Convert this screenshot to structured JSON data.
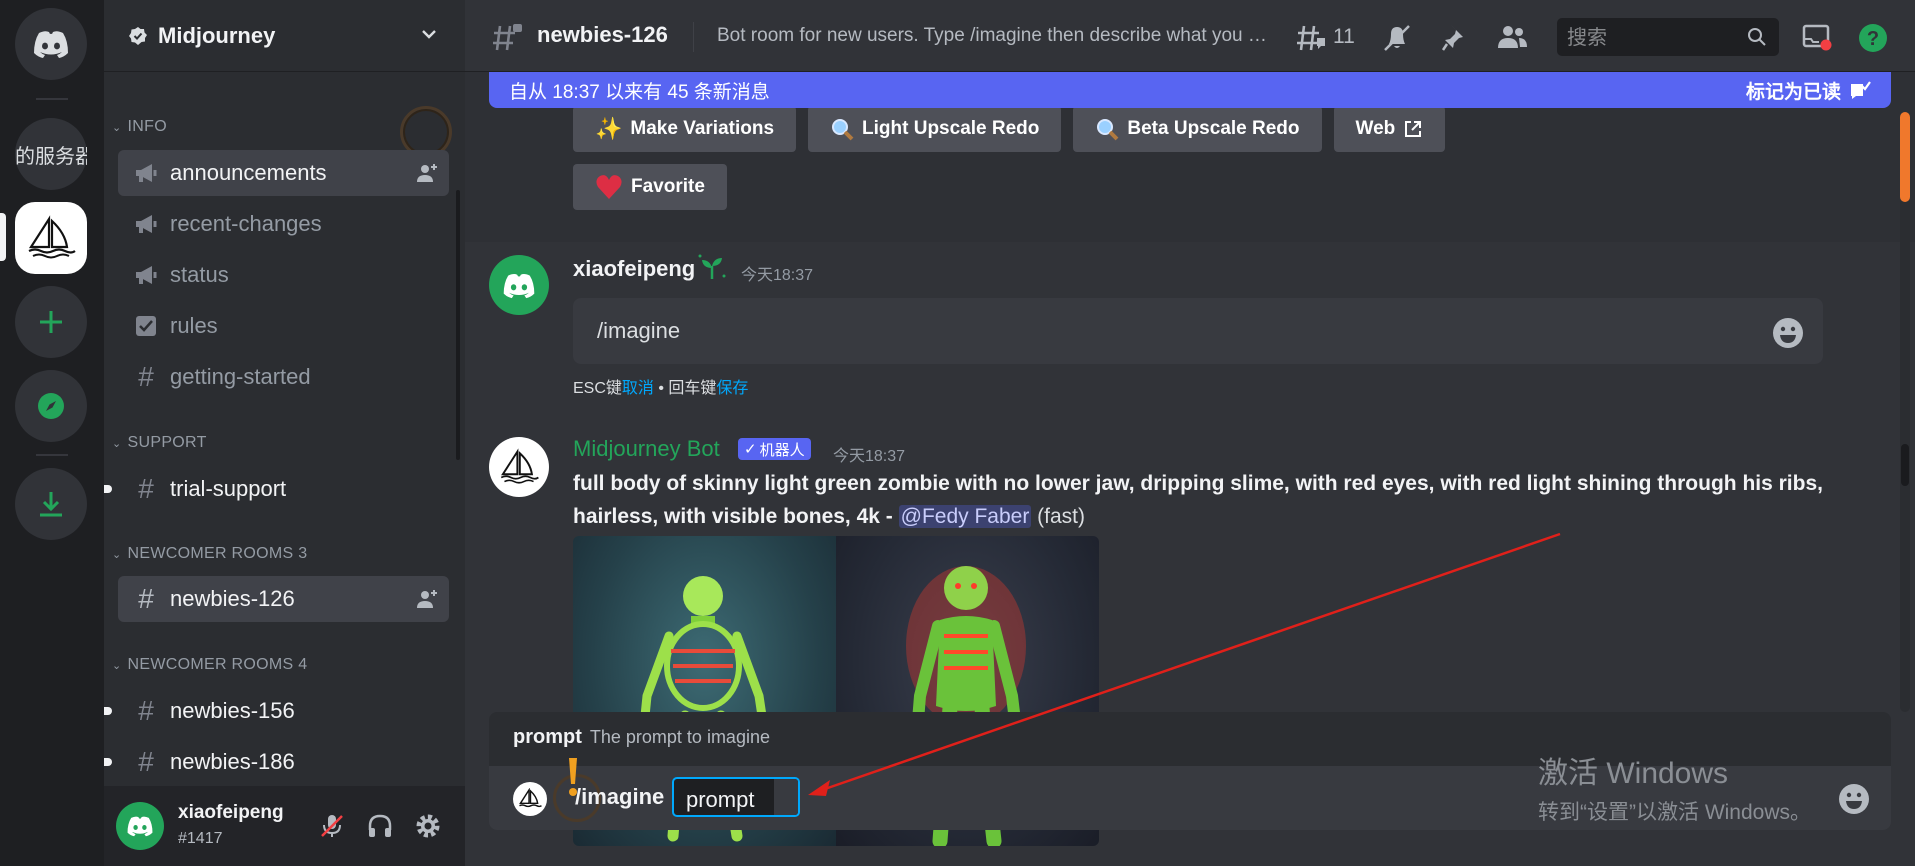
{
  "server_rail": {
    "servers_label": "的服务器"
  },
  "guild": {
    "name": "Midjourney"
  },
  "sidebar": {
    "categories": {
      "info": "INFO",
      "support": "SUPPORT",
      "rooms3": "NEWCOMER ROOMS 3",
      "rooms4": "NEWCOMER ROOMS 4"
    },
    "channels": {
      "announcements": "announcements",
      "recent_changes": "recent-changes",
      "status": "status",
      "rules": "rules",
      "getting_started": "getting-started",
      "trial_support": "trial-support",
      "newbies_126": "newbies-126",
      "newbies_156": "newbies-156",
      "newbies_186": "newbies-186"
    }
  },
  "user": {
    "name": "xiaofeipeng",
    "tag": "#1417"
  },
  "header": {
    "channel": "newbies-126",
    "topic": "Bot room for new users. Type /imagine then describe what you want to draw.",
    "thread_count": "11",
    "search_placeholder": "搜索"
  },
  "new_messages_bar": {
    "text": "自从 18:37 以来有 45 条新消息",
    "mark_read": "标记为已读"
  },
  "buttons": {
    "make_variations": "Make Variations",
    "light_upscale": "Light Upscale Redo",
    "beta_upscale": "Beta Upscale Redo",
    "web": "Web",
    "favorite": "Favorite"
  },
  "message_edit": {
    "author": "xiaofeipeng",
    "time": "今天18:37",
    "value": "/imagine",
    "hint_esc": "ESC键",
    "hint_cancel": "取消",
    "hint_sep": " • 回车键",
    "hint_save": "保存"
  },
  "bot_message": {
    "author": "Midjourney Bot",
    "badge": "机器人",
    "time": "今天18:37",
    "prompt": "full body of skinny light green zombie with no lower jaw, dripping slime, with red eyes, with red light shining through his ribs, hairless, with visible bones, 4k",
    "dash": " - ",
    "mention": "@Fedy Faber",
    "speed": "(fast)"
  },
  "composer": {
    "option_name": "prompt",
    "option_desc": "The prompt to imagine",
    "command": "/imagine",
    "param_label": "prompt"
  },
  "watermark": {
    "line1": "激活 Windows",
    "line2": "转到“设置”以激活 Windows。"
  },
  "colors": {
    "accent": "#5865f2",
    "green": "#23a55a",
    "link": "#00a8fc"
  }
}
